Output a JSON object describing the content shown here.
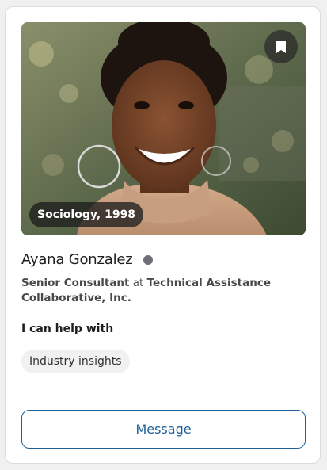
{
  "profile": {
    "badge": "Sociology, 1998",
    "name": "Ayana Gonzalez",
    "role_title": "Senior Consultant",
    "role_connector": " at ",
    "organization": "Technical Assistance Collaborative, Inc.",
    "help_heading": "I can help with",
    "help_tags": [
      "Industry insights"
    ],
    "status": "offline"
  },
  "actions": {
    "message_label": "Message",
    "bookmark_icon": "bookmark-icon"
  },
  "colors": {
    "accent": "#1f5f99",
    "status_dot": "#6e6e78"
  }
}
